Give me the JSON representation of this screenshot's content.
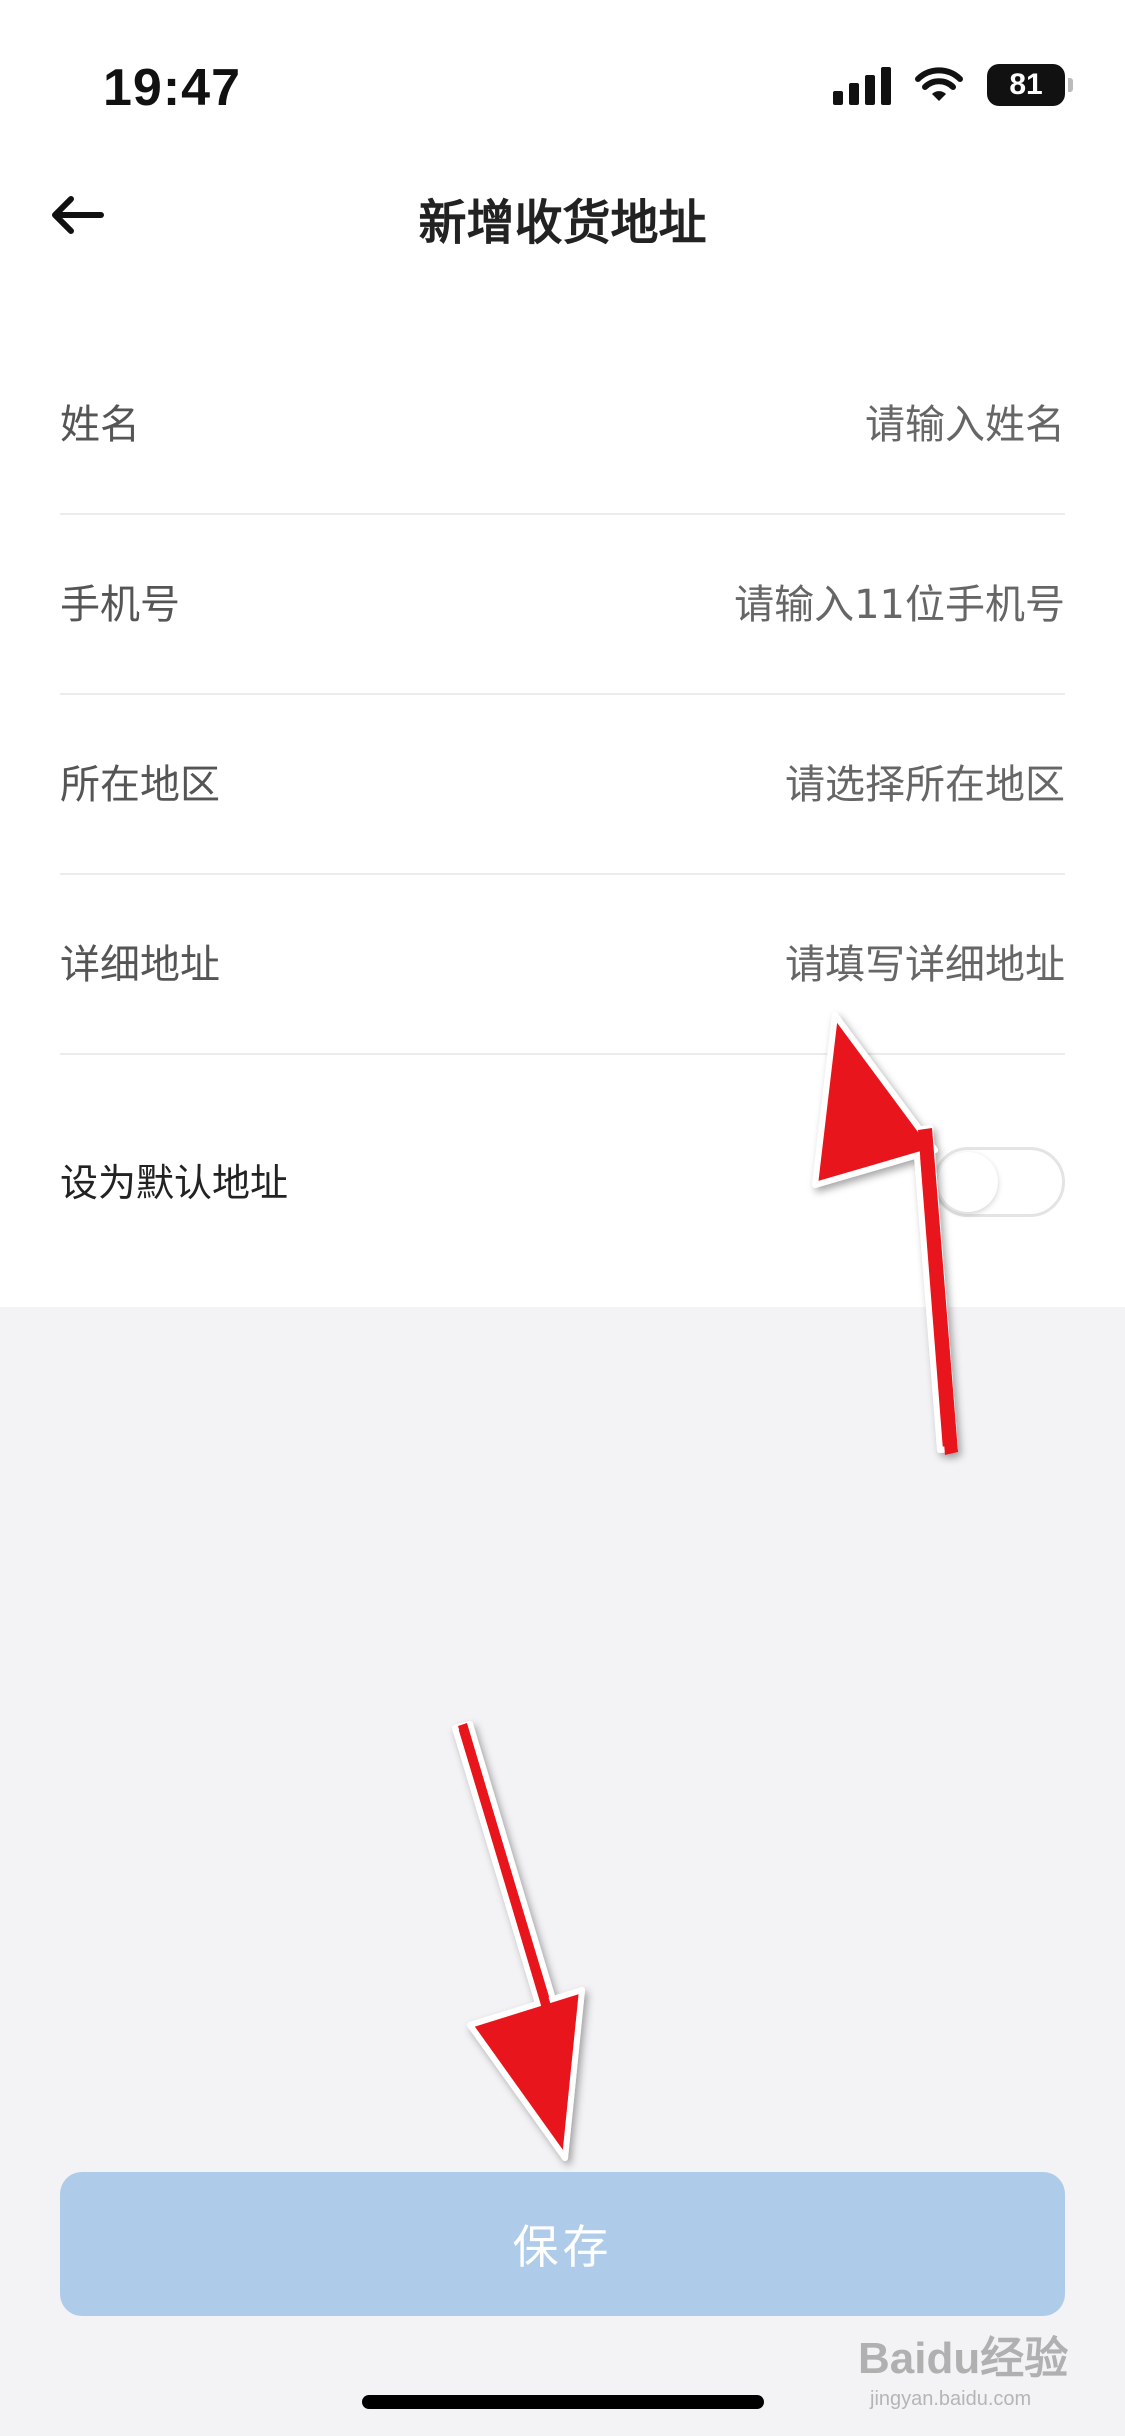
{
  "status_bar": {
    "time": "19:47",
    "battery": "81",
    "icons": [
      "signal-icon",
      "wifi-icon",
      "battery-icon"
    ]
  },
  "nav": {
    "back_icon": "back-arrow-icon",
    "title": "新增收货地址"
  },
  "form": {
    "name": {
      "label": "姓名",
      "placeholder": "请输入姓名",
      "value": ""
    },
    "phone": {
      "label": "手机号",
      "placeholder": "请输入11位手机号",
      "value": ""
    },
    "region": {
      "label": "所在地区",
      "placeholder": "请选择所在地区",
      "value": ""
    },
    "address": {
      "label": "详细地址",
      "placeholder": "请填写详细地址",
      "value": ""
    },
    "default": {
      "label": "设为默认地址",
      "enabled": false
    }
  },
  "save_button": {
    "label": "保存"
  },
  "watermark": {
    "text": "Baidu经验",
    "sub": "jingyan.baidu.com"
  },
  "colors": {
    "background": "#f3f3f6",
    "save_button": "#afcbea",
    "annotation_arrow": "#e8141a"
  }
}
